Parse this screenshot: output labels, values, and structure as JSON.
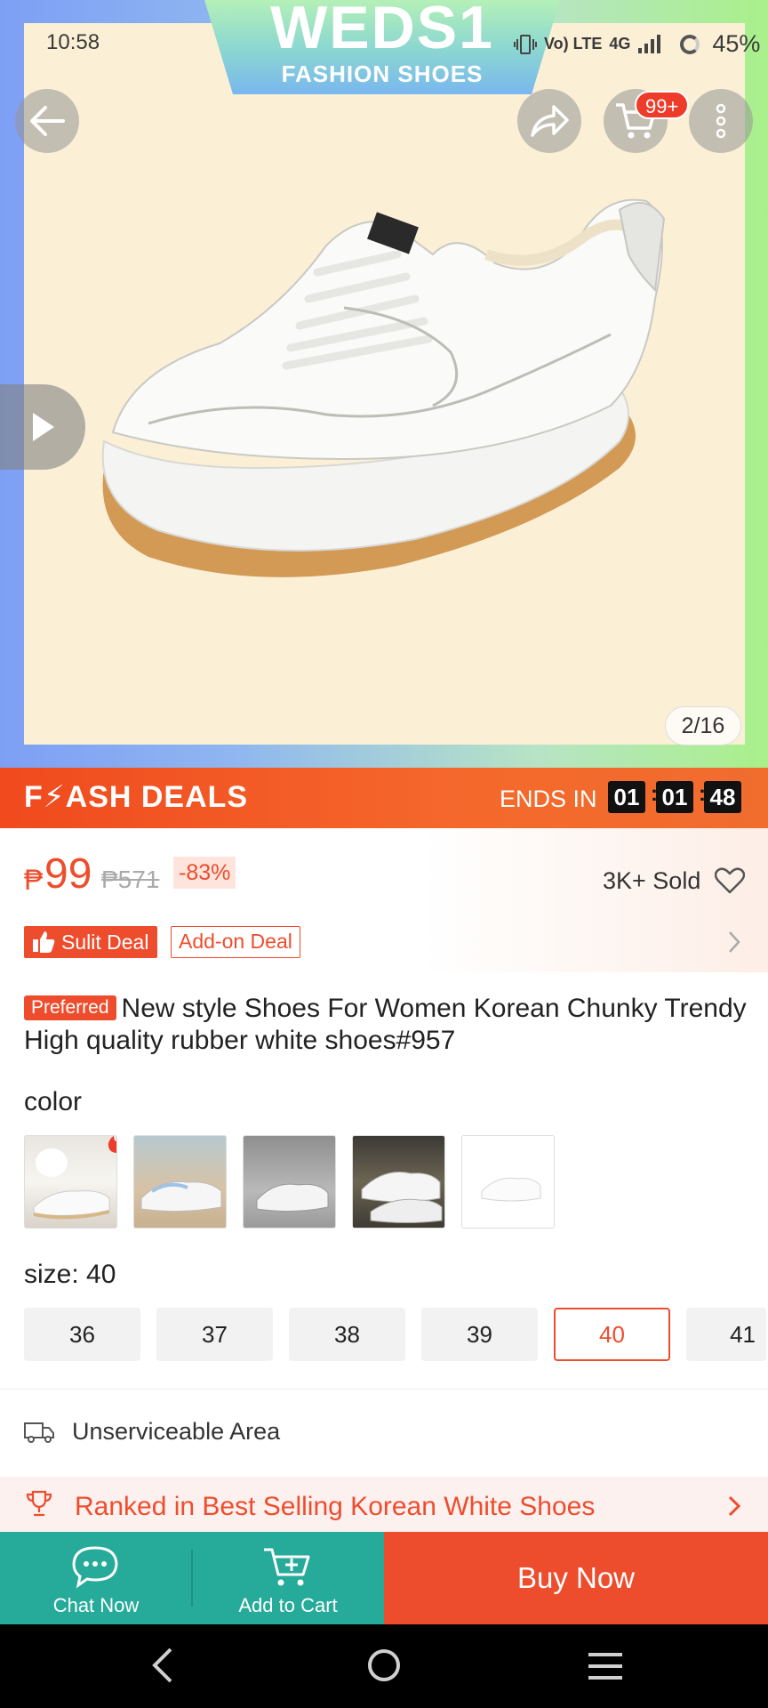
{
  "status_bar": {
    "time": "10:58",
    "network_small": "Vo) LTE",
    "network": "4G",
    "battery": "45%"
  },
  "banner": {
    "brand": "WEDS1",
    "subtitle": "FASHION SHOES"
  },
  "top_actions": {
    "cart_badge": "99+"
  },
  "gallery": {
    "counter": "2/16"
  },
  "flash_deal": {
    "title": "F⚡ASH DEALS",
    "ends_label": "ENDS IN",
    "hours": "01",
    "minutes": "01",
    "seconds": "48"
  },
  "price": {
    "currency": "₱",
    "current": "99",
    "original": "₱571",
    "discount": "-83%",
    "sold": "3K+ Sold"
  },
  "deal_tags": {
    "sulit": "Sulit Deal",
    "addon": "Add-on Deal"
  },
  "product": {
    "badge": "Preferred",
    "title": "New style Shoes For Women Korean Chunky Trendy High quality rubber white shoes#957"
  },
  "variations": {
    "color_label": "color",
    "size_label": "size: 40",
    "sizes": [
      "36",
      "37",
      "38",
      "39",
      "40",
      "41"
    ],
    "selected_size": "40"
  },
  "shipping": {
    "text": "Unserviceable Area"
  },
  "ranking": {
    "text": "Ranked in Best Selling Korean White Shoes"
  },
  "bottom_bar": {
    "chat": "Chat Now",
    "cart": "Add to Cart",
    "buy": "Buy Now"
  },
  "colors": {
    "accent": "#ee4d2d",
    "teal": "#26aa99"
  }
}
